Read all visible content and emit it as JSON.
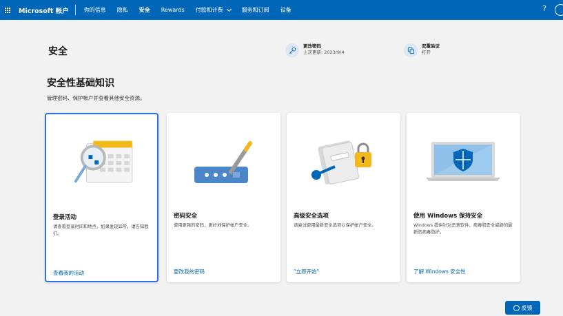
{
  "topbar": {
    "brand": "Microsoft 帐户",
    "nav": [
      {
        "label": "你的信息",
        "active": false
      },
      {
        "label": "隐私",
        "active": false
      },
      {
        "label": "安全",
        "active": true
      },
      {
        "label": "Rewards",
        "active": false
      },
      {
        "label": "付款和计费",
        "active": false,
        "dropdown": true
      },
      {
        "label": "服务和订阅",
        "active": false
      },
      {
        "label": "设备",
        "active": false
      }
    ],
    "help": "?"
  },
  "header": {
    "title": "安全",
    "password": {
      "title": "更改密码",
      "sub": "上次更新: 2023/9/4"
    },
    "two_step": {
      "title": "双重验证",
      "sub": "打开"
    }
  },
  "section": {
    "title": "安全性基础知识",
    "subtitle": "管理密码、保护帐户并查看其他安全资源。"
  },
  "cards": [
    {
      "title": "登录活动",
      "desc": "请查看登录时间和地点。如果发现异常，请告知我们。",
      "link": "查看我的活动",
      "icon": "calendar-magnifier-illustration"
    },
    {
      "title": "密码安全",
      "desc": "使用更强的密码，更好地保护帐户安全。",
      "link": "更改我的密码",
      "icon": "password-pen-illustration"
    },
    {
      "title": "高级安全选项",
      "desc": "请尝试使用最新安全选项以保护帐户安全。",
      "link": "\"立即开始\"",
      "icon": "key-lock-illustration"
    },
    {
      "title": "使用 Windows 保持安全",
      "desc": "Windows 提供针对恶意软件、病毒和安全威胁的最新防病毒防护。",
      "link": "了解 Windows 安全性",
      "icon": "laptop-shield-illustration"
    }
  ],
  "feedback": "反馈",
  "colors": {
    "brand": "#0067b8",
    "accent_yellow": "#f2b91b",
    "selected_border": "#2f6fe4"
  }
}
